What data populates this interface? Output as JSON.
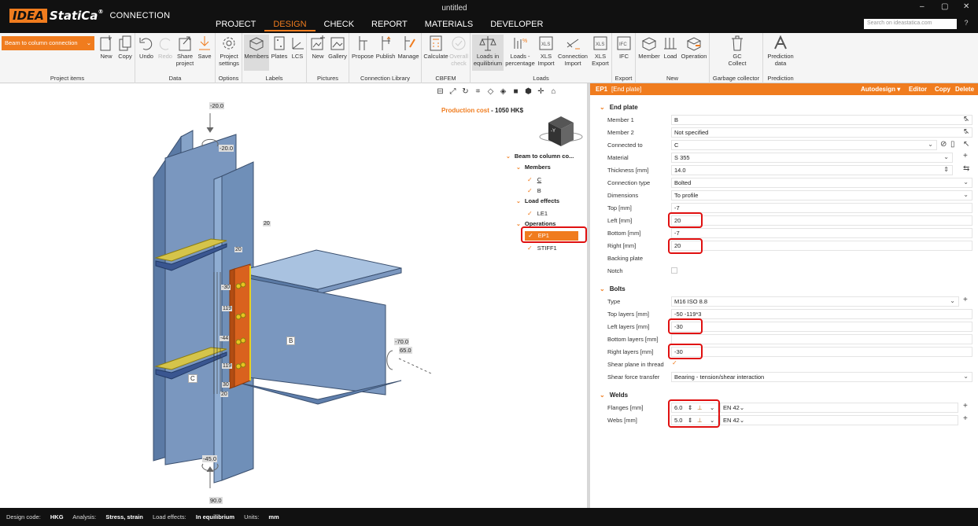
{
  "window": {
    "title": "untitled",
    "controls": [
      "–",
      "▢",
      "✕"
    ]
  },
  "brand": {
    "idea": "IDEA",
    "statica": "StatiCa",
    "reg": "®",
    "product": "CONNECTION"
  },
  "menu_tabs": [
    "PROJECT",
    "DESIGN",
    "CHECK",
    "REPORT",
    "MATERIALS",
    "DEVELOPER"
  ],
  "search": {
    "placeholder": "Search on ideastatica.com",
    "help": "?"
  },
  "ribbon": {
    "project_dropdown": "Beam to column connection",
    "groups": {
      "project_items": "Project items",
      "data": "Data",
      "options": "Options",
      "labels": "Labels",
      "pictures": "Pictures",
      "connection_library": "Connection Library",
      "cbfem": "CBFEM",
      "loads": "Loads",
      "export": "Export",
      "new": "New",
      "garbage": "Garbage collector",
      "prediction": "Prediction"
    },
    "buttons": {
      "new": "New",
      "copy": "Copy",
      "undo": "Undo",
      "redo": "Redo",
      "share": "Share project",
      "save": "Save",
      "project_settings": "Project settings",
      "members": "Members",
      "plates": "Plates",
      "lcs": "LCS",
      "pic_new": "New",
      "gallery": "Gallery",
      "propose": "Propose",
      "publish": "Publish",
      "manage": "Manage",
      "calculate": "Calculate",
      "overall_check": "Overall check",
      "loads_equilibrium": "Loads in equilibrium",
      "loads_percentage": "Loads - percentage",
      "xls_import": "XLS Import",
      "connection_import": "Connection Import",
      "xls_export": "XLS Export",
      "ifc": "IFC",
      "member": "Member",
      "load": "Load",
      "operation": "Operation",
      "gc_collect": "GC Collect",
      "prediction_data": "Prediction data"
    }
  },
  "viewport": {
    "production_cost_label": "Production cost",
    "production_cost_value": "1050 HK$",
    "member_labels": {
      "b": "B",
      "c": "C"
    },
    "dimension_labels": [
      "-20.0",
      "-20.0",
      "20",
      "20",
      "-30",
      "119",
      "-44",
      "119",
      "30",
      "20",
      "-70.0",
      "65.0",
      "-45.0",
      "90.0"
    ],
    "view_cube_label": "-Y"
  },
  "tree": {
    "root": "Beam to column co...",
    "members_label": "Members",
    "members": [
      "C",
      "B"
    ],
    "load_effects_label": "Load effects",
    "load_effects": [
      "LE1"
    ],
    "operations_label": "Operations",
    "operations": [
      "EP1",
      "STIFF1"
    ]
  },
  "panel": {
    "header_id": "EP1",
    "header_name": "[End plate]",
    "actions": {
      "autodesign": "Autodesign",
      "editor": "Editor",
      "copy": "Copy",
      "delete": "Delete"
    },
    "end_plate": {
      "section": "End plate",
      "member1_label": "Member 1",
      "member1": "B",
      "member2_label": "Member 2",
      "member2": "Not specified",
      "connected_label": "Connected to",
      "connected": "C",
      "material_label": "Material",
      "material": "S 355",
      "thickness_label": "Thickness [mm]",
      "thickness": "14.0",
      "conntype_label": "Connection type",
      "conntype": "Bolted",
      "dimensions_label": "Dimensions",
      "dimensions": "To profile",
      "top_label": "Top [mm]",
      "top": "-7",
      "left_label": "Left [mm]",
      "left": "20",
      "bottom_label": "Bottom [mm]",
      "bottom": "-7",
      "right_label": "Right [mm]",
      "right": "20",
      "backing_label": "Backing plate",
      "notch_label": "Notch"
    },
    "bolts": {
      "section": "Bolts",
      "type_label": "Type",
      "type": "M16 ISO 8.8",
      "top_layers_label": "Top layers [mm]",
      "top_layers": "-50 -119*3",
      "left_layers_label": "Left layers [mm]",
      "left_layers": "-30",
      "bottom_layers_label": "Bottom layers [mm]",
      "bottom_layers": "",
      "right_layers_label": "Right layers [mm]",
      "right_layers": "-30",
      "shear_thread_label": "Shear plane in thread",
      "shear_transfer_label": "Shear force transfer",
      "shear_transfer": "Bearing - tension/shear interaction"
    },
    "welds": {
      "section": "Welds",
      "flanges_label": "Flanges [mm]",
      "flanges": "6.0",
      "flanges_type": "EN 42",
      "webs_label": "Webs [mm]",
      "webs": "5.0",
      "webs_type": "EN 42"
    }
  },
  "status": {
    "design_code_label": "Design code:",
    "design_code": "HKG",
    "analysis_label": "Analysis:",
    "analysis": "Stress, strain",
    "load_effects_label": "Load effects:",
    "load_effects": "In equilibrium",
    "units_label": "Units:",
    "units": "mm"
  },
  "colors": {
    "accent": "#f07c1e",
    "highlight": "#e01010",
    "steel": "#6f8fb8",
    "plate": "#d9621e",
    "weld": "#e8d020"
  }
}
